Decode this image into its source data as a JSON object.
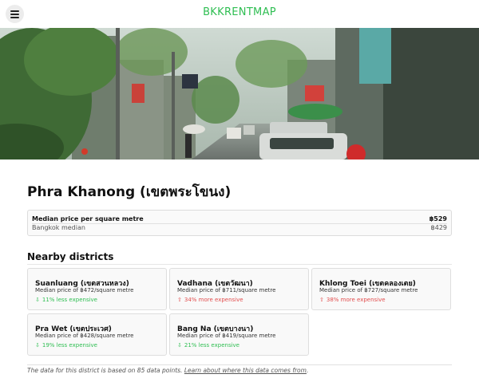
{
  "header": {
    "brand": "BKKRENTMAP",
    "brand_color": "#2fbe52",
    "menu_icon": "hamburger-menu-icon"
  },
  "hero": {
    "alt": "Bangkok street scene"
  },
  "district": {
    "title": "Phra Khanong (เขตพระโขนง)"
  },
  "price": {
    "main_label": "Median price per square metre",
    "main_value": "฿529",
    "sub_label": "Bangkok median",
    "sub_value": "฿429"
  },
  "nearby": {
    "title": "Nearby districts",
    "less_color": "#2fbe52",
    "more_color": "#e24e4e",
    "items": [
      {
        "name": "Suanluang (เขตสวนหลวง)",
        "median": "Median price of ฿472/square metre",
        "diff": "11% less expensive",
        "direction": "less"
      },
      {
        "name": "Vadhana (เขตวัฒนา)",
        "median": "Median price of ฿711/square metre",
        "diff": "34% more expensive",
        "direction": "more"
      },
      {
        "name": "Khlong Toei (เขตคลองเตย)",
        "median": "Median price of ฿727/square metre",
        "diff": "38% more expensive",
        "direction": "more"
      },
      {
        "name": "Pra Wet (เขตประเวศ)",
        "median": "Median price of ฿428/square metre",
        "diff": "19% less expensive",
        "direction": "less"
      },
      {
        "name": "Bang Na (เขตบางนา)",
        "median": "Median price of ฿419/square metre",
        "diff": "21% less expensive",
        "direction": "less"
      }
    ]
  },
  "footer": {
    "note_prefix": "The data for this district is based on 85 data points. ",
    "note_link": "Learn about where this data comes from",
    "note_suffix": "."
  }
}
